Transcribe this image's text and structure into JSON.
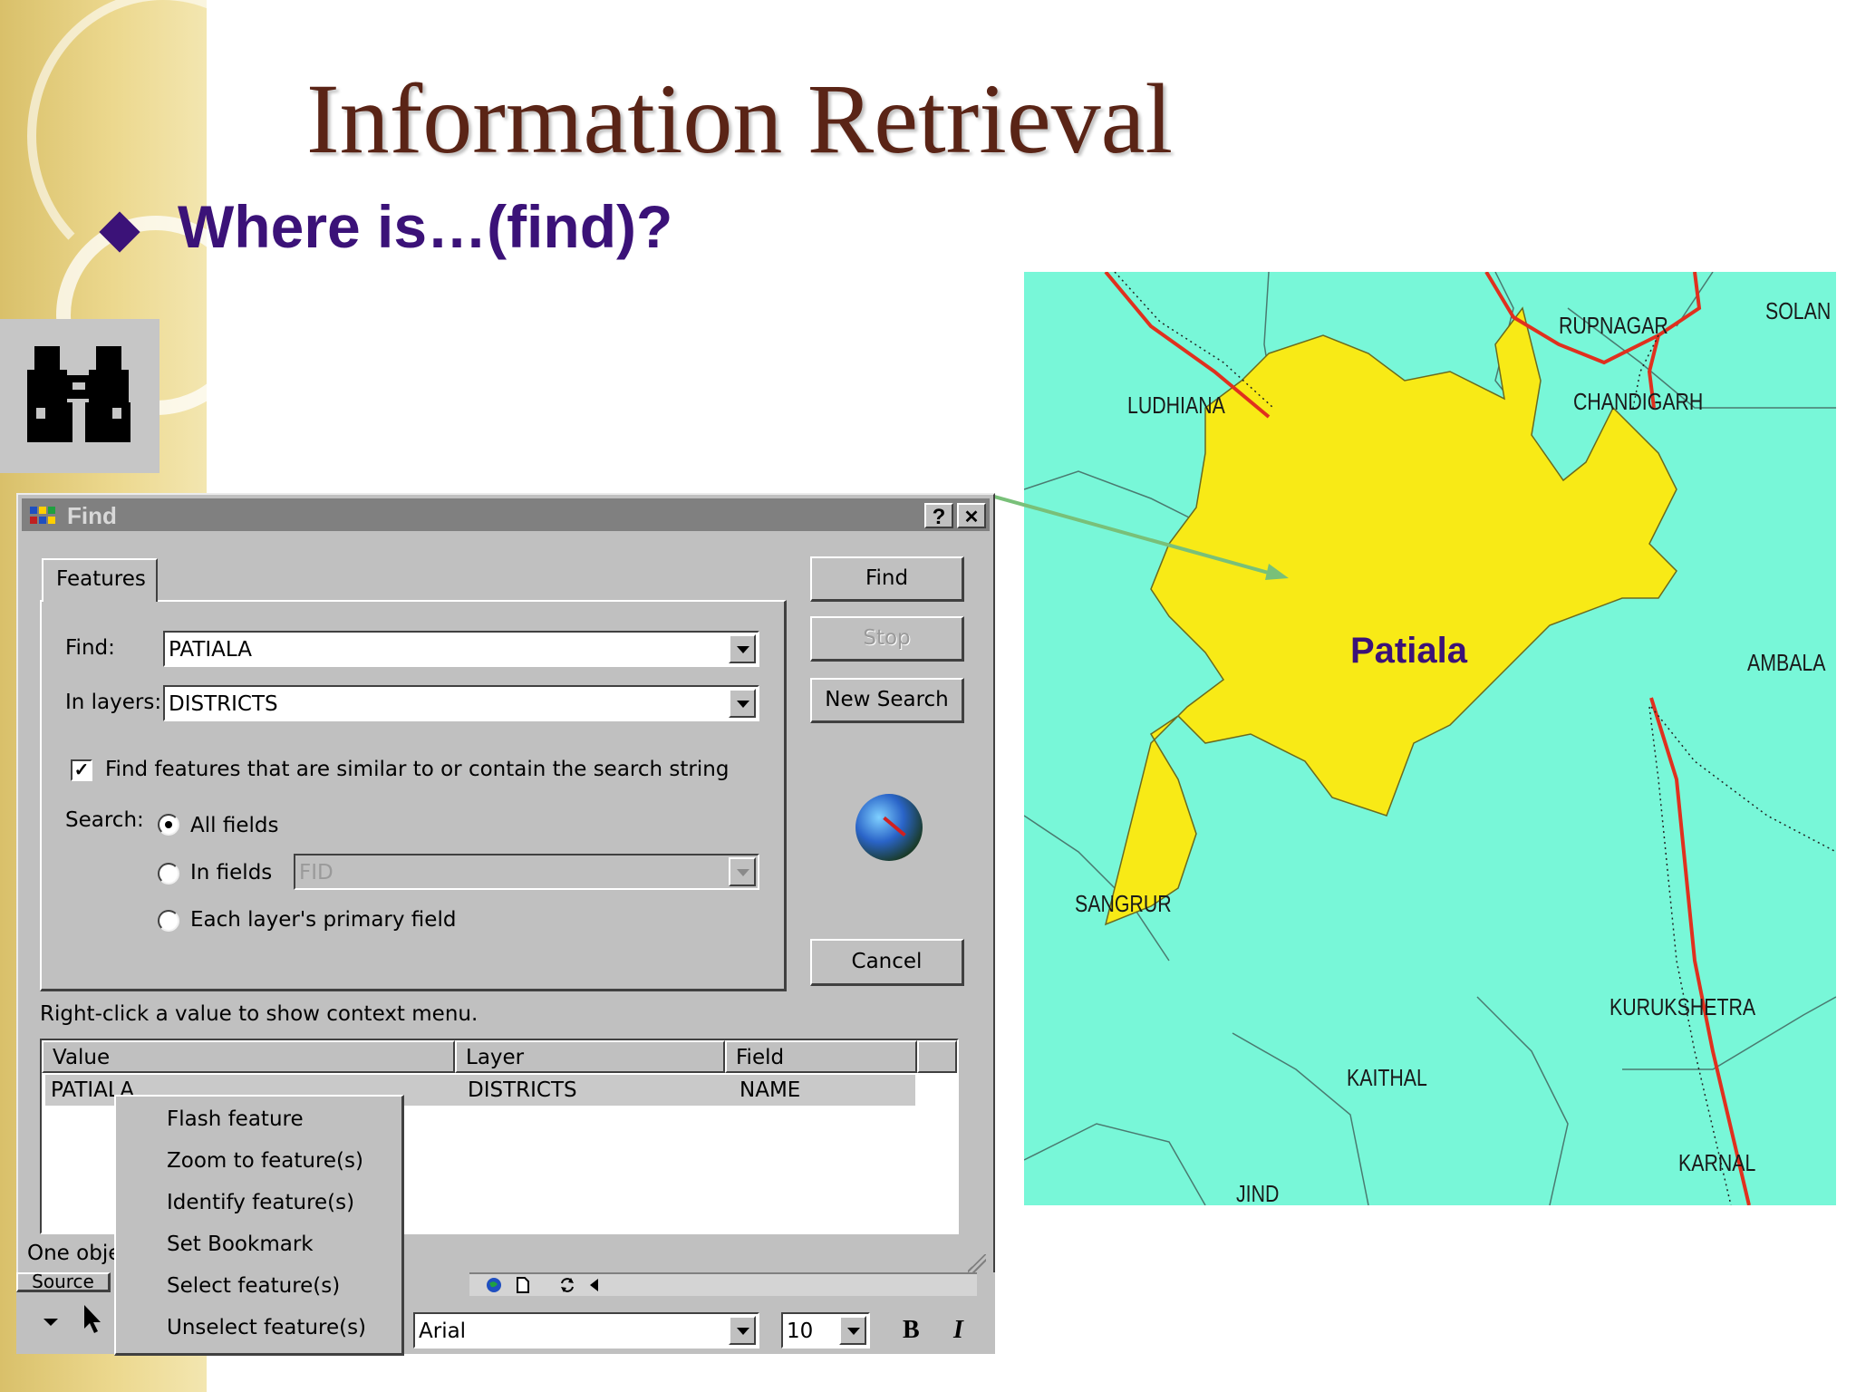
{
  "slide": {
    "title": "Information Retrieval",
    "bullet": "Where is…(find)?"
  },
  "icons": {
    "binoculars": "binoculars-icon",
    "globe": "globe-search-icon",
    "app": "app-icon"
  },
  "colors": {
    "title": "#5a2416",
    "bullet": "#3b1278",
    "map_water": "#78f7d8",
    "map_highlight": "#f8ea16",
    "road": "#e0301e",
    "pointer": "#79c079"
  },
  "dialog": {
    "title": "Find",
    "help_button": "?",
    "close_button": "✕",
    "tab_features": "Features",
    "find_label": "Find:",
    "find_value": "PATIALA",
    "layers_label": "In layers:",
    "layers_value": "DISTRICTS",
    "similar_checkbox_label": "Find features that are similar to or contain the search string",
    "similar_checked": true,
    "search_label": "Search:",
    "option_all_fields": "All fields",
    "option_in_fields": "In fields",
    "in_fields_value": "FID",
    "option_primary_field": "Each layer's primary field",
    "find_button": "Find",
    "stop_button": "Stop",
    "new_search_button": "New Search",
    "cancel_button": "Cancel",
    "hint": "Right-click a value to show context menu.",
    "columns": [
      "Value",
      "Layer",
      "Field"
    ],
    "results": [
      {
        "value": "PATIALA",
        "layer": "DISTRICTS",
        "field": "NAME"
      }
    ],
    "status_fragment": "One obje",
    "source_tab_fragment": "Source"
  },
  "context_menu": {
    "items": [
      "Flash feature",
      "Zoom to feature(s)",
      "Identify feature(s)",
      "Set Bookmark",
      "Select feature(s)",
      "Unselect feature(s)"
    ]
  },
  "toolbar": {
    "font_value": "Arial",
    "size_value": "10",
    "bold_label": "B",
    "italic_label": "I"
  },
  "map": {
    "highlight_label": "Patiala",
    "districts": [
      "RUPNAGAR",
      "SOLAN",
      "LUDHIANA",
      "CHANDIGARH",
      "AMBALA",
      "SANGRUR",
      "KURUKSHETRA",
      "KAITHAL",
      "KARNAL",
      "JIND"
    ]
  }
}
